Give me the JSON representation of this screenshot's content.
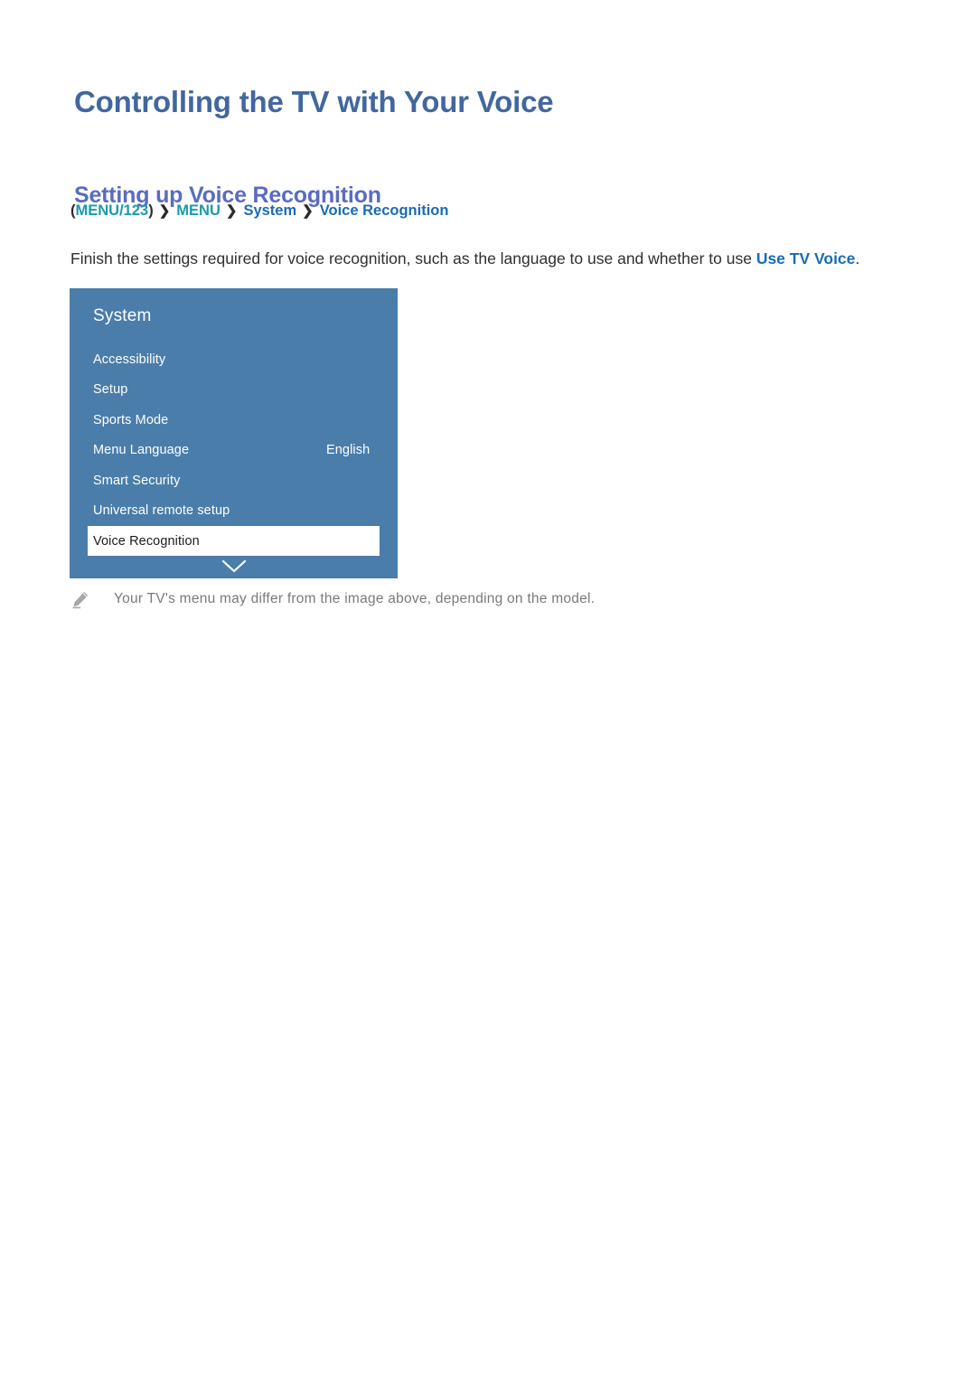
{
  "page": {
    "title": "Controlling the TV with Your Voice",
    "section_title": "Setting up Voice Recognition"
  },
  "breadcrumb": {
    "open_paren": "(",
    "item1": "MENU/123",
    "close_paren": ")",
    "sep": "❯",
    "item2": "MENU",
    "item3": "System",
    "item4": "Voice Recognition"
  },
  "paragraph": {
    "lead": "Finish the settings required for voice recognition, such as the language to use and whether to use ",
    "highlight": "Use TV Voice",
    "trail": "."
  },
  "tv_menu": {
    "title": "System",
    "chevron_icon": "chevron-down-icon",
    "rows": [
      {
        "label": "Accessibility",
        "value": "",
        "selected": false
      },
      {
        "label": "Setup",
        "value": "",
        "selected": false
      },
      {
        "label": "Sports Mode",
        "value": "",
        "selected": false
      },
      {
        "label": "Menu Language",
        "value": "English",
        "selected": false
      },
      {
        "label": "Smart Security",
        "value": "",
        "selected": false
      },
      {
        "label": "Universal remote setup",
        "value": "",
        "selected": false
      },
      {
        "label": "Voice Recognition",
        "value": "",
        "selected": true
      }
    ]
  },
  "note": {
    "icon": "pencil-icon",
    "text": "Your TV's menu may differ from the image above, depending on the model."
  },
  "colors": {
    "title": "#42679f",
    "section_title": "#5a6bc0",
    "breadcrumb_teal": "#1a9ba8",
    "breadcrumb_blue": "#1a6cb5",
    "body_text": "#2f2f2f",
    "highlight_blue": "#1a6cb5",
    "tv_menu_bg": "#4a7daa",
    "tv_menu_text": "#ffffff",
    "tv_selected_bg": "#ffffff",
    "tv_selected_text": "#1c1c1c",
    "note_text": "#7a7a7a"
  }
}
